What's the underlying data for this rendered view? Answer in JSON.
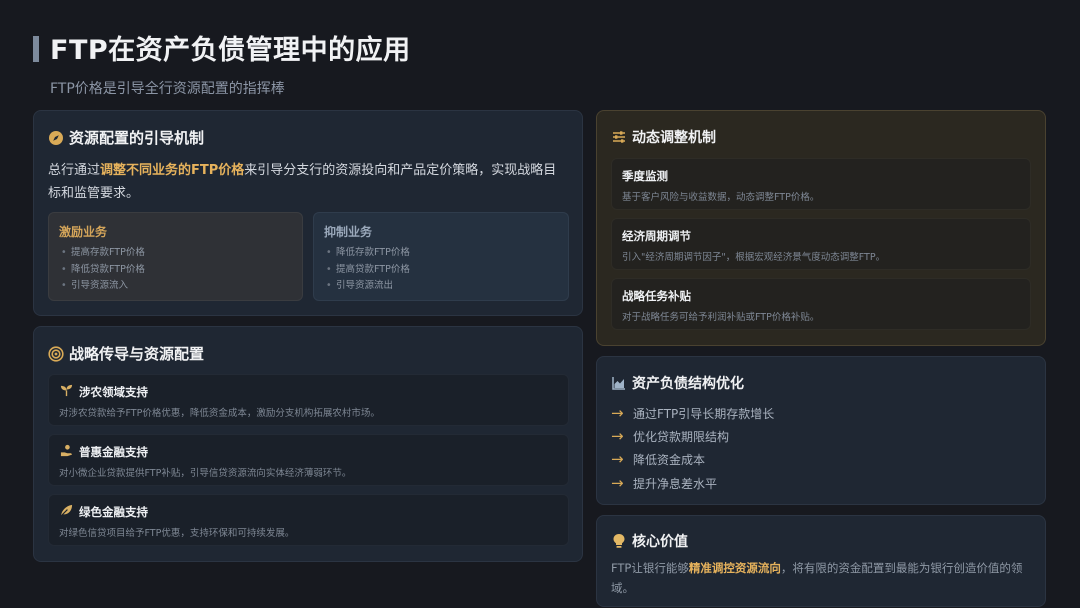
{
  "header": {
    "title": "FTP在资产负债管理中的应用",
    "subtitle": "FTP价格是引导全行资源配置的指挥棒"
  },
  "guide": {
    "title": "资源配置的引导机制",
    "icon": "compass-icon",
    "intro_pre": "总行通过",
    "intro_hl": "调整不同业务的FTP价格",
    "intro_post": "来引导分支行的资源投向和产品定价策略，实现战略目标和监管要求。",
    "incentive": {
      "title": "激励业务",
      "items": [
        "提高存款FTP价格",
        "降低贷款FTP价格",
        "引导资源流入"
      ]
    },
    "restrict": {
      "title": "抑制业务",
      "items": [
        "降低存款FTP价格",
        "提高贷款FTP价格",
        "引导资源流出"
      ]
    }
  },
  "strategy": {
    "title": "战略传导与资源配置",
    "icon": "target-icon",
    "items": [
      {
        "icon": "seedling-icon",
        "title": "涉农领域支持",
        "desc": "对涉农贷款给予FTP价格优惠，降低资金成本，激励分支机构拓展农村市场。"
      },
      {
        "icon": "hand-coin-icon",
        "title": "普惠金融支持",
        "desc": "对小微企业贷款提供FTP补贴，引导信贷资源流向实体经济薄弱环节。"
      },
      {
        "icon": "leaf-icon",
        "title": "绿色金融支持",
        "desc": "对绿色信贷项目给予FTP优惠，支持环保和可持续发展。"
      }
    ]
  },
  "dynamic": {
    "title": "动态调整机制",
    "icon": "sliders-icon",
    "items": [
      {
        "title": "季度监测",
        "desc": "基于客户风险与收益数据，动态调整FTP价格。"
      },
      {
        "title": "经济周期调节",
        "desc": "引入\"经济周期调节因子\"，根据宏观经济景气度动态调整FTP。"
      },
      {
        "title": "战略任务补贴",
        "desc": "对于战略任务可给予利润补贴或FTP价格补贴。"
      }
    ]
  },
  "structure": {
    "title": "资产负债结构优化",
    "icon": "area-chart-icon",
    "items": [
      "通过FTP引导长期存款增长",
      "优化贷款期限结构",
      "降低资金成本",
      "提升净息差水平"
    ]
  },
  "core": {
    "title": "核心价值",
    "icon": "lightbulb-icon",
    "text_pre": "FTP让银行能够",
    "text_hl": "精准调控资源流向",
    "text_post": "，将有限的资金配置到最能为银行创造价值的领域。"
  },
  "colors": {
    "accent": "#e6b25c",
    "background": "#17191f",
    "card": "#1f2733"
  }
}
